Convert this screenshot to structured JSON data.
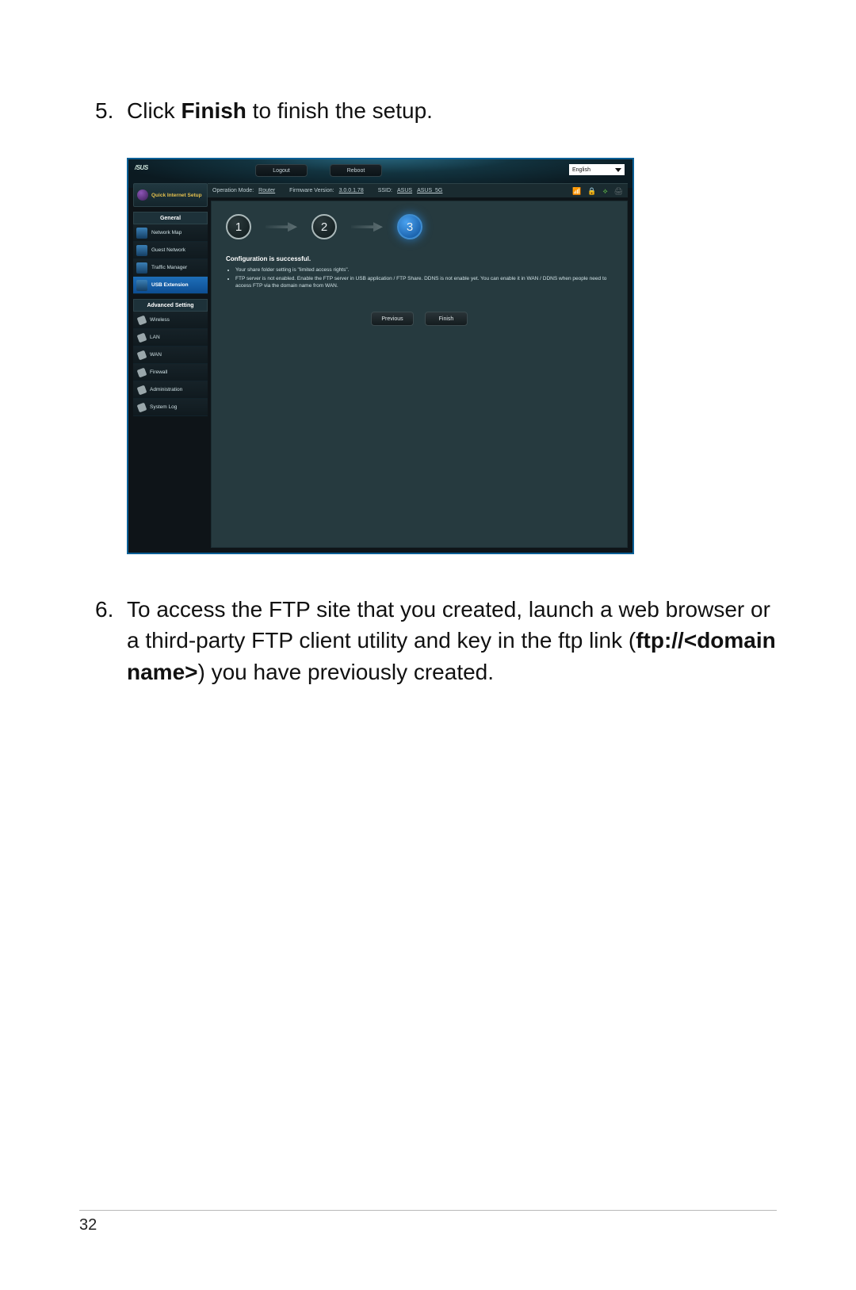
{
  "page_number": "32",
  "step5": {
    "num": "5.",
    "pre": "Click ",
    "bold": "Finish",
    "post": " to finish the setup."
  },
  "step6": {
    "num": "6.",
    "line_pre": "To access the FTP site that you created, launch a web browser or a third-party FTP client utility and key in the ftp link (",
    "bold": "ftp://<domain name>",
    "line_post": ") you have previously created."
  },
  "router": {
    "logo": "/SUS",
    "logout": "Logout",
    "reboot": "Reboot",
    "language": "English",
    "info": {
      "op_label": "Operation Mode:",
      "op_value": "Router",
      "fw_label": "Firmware Version:",
      "fw_value": "3.0.0.1.78",
      "ssid_label": "SSID:",
      "ssid1": "ASUS",
      "ssid2": "ASUS_5G"
    },
    "qis": "Quick Internet Setup",
    "general_header": "General",
    "general": [
      "Network Map",
      "Guest Network",
      "Traffic Manager",
      "USB Extension"
    ],
    "adv_header": "Advanced Setting",
    "advanced": [
      "Wireless",
      "LAN",
      "WAN",
      "Firewall",
      "Administration",
      "System Log"
    ],
    "steps": [
      "1",
      "2",
      "3"
    ],
    "conf_title": "Configuration is successful.",
    "bullets": [
      "Your share folder setting is \"limited access rights\".",
      "FTP server is not enabled. Enable the FTP server in USB application / FTP Share. DDNS is not enable yet. You can enable it in WAN / DDNS when people need to access FTP via the domain name from WAN."
    ],
    "btn_prev": "Previous",
    "btn_finish": "Finish"
  }
}
